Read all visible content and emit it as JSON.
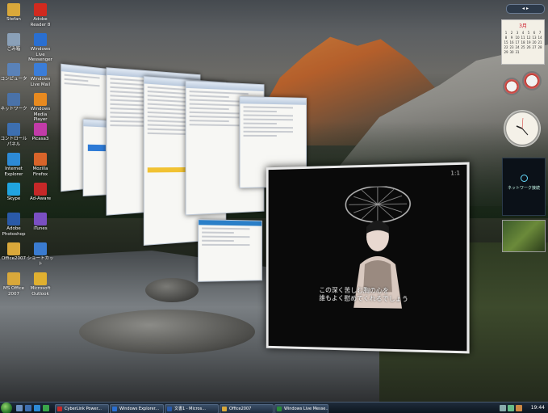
{
  "desktop_icons": [
    {
      "label": "Stefan",
      "color": "#d9a83a"
    },
    {
      "label": "Adobe Reader 8",
      "color": "#d12a1f"
    },
    {
      "label": "ごみ箱",
      "color": "#8aa0b8"
    },
    {
      "label": "Windows Live Messenger",
      "color": "#2a6fd1"
    },
    {
      "label": "コンピュータ",
      "color": "#5a82b8"
    },
    {
      "label": "Windows Live Mail",
      "color": "#3b7dd8"
    },
    {
      "label": "ネットワーク",
      "color": "#4a72a8"
    },
    {
      "label": "Windows Media Player",
      "color": "#e88a1f"
    },
    {
      "label": "コントロール パネル",
      "color": "#3d6fb0"
    },
    {
      "label": "Picasa3",
      "color": "#c23ba8"
    },
    {
      "label": "Internet Explorer",
      "color": "#2d8ad6"
    },
    {
      "label": "Mozilla Firefox",
      "color": "#d8642a"
    },
    {
      "label": "Skype",
      "color": "#20a4e0"
    },
    {
      "label": "Ad-Aware",
      "color": "#c62828"
    },
    {
      "label": "Adobe Photoshop",
      "color": "#2a5aa8"
    },
    {
      "label": "iTunes",
      "color": "#7a4fc2"
    },
    {
      "label": "Office2007",
      "color": "#d9a83a"
    },
    {
      "label": "ショートカット",
      "color": "#3a7bd0"
    },
    {
      "label": "MS Office 2007",
      "color": "#d9a83a"
    },
    {
      "label": "Microsoft Outlook",
      "color": "#e0b030"
    }
  ],
  "video_window": {
    "channel": "1:1",
    "subtitle": "この深く苦しむ胸の心を\n誰もよく慰めてくれるでしょう"
  },
  "gadgets": {
    "sidebar_toggle": "◂ ▸",
    "calendar_month": "3月",
    "calendar_days": [
      "1",
      "2",
      "3",
      "4",
      "5",
      "6",
      "7",
      "8",
      "9",
      "10",
      "11",
      "12",
      "13",
      "14",
      "15",
      "16",
      "17",
      "18",
      "19",
      "20",
      "21",
      "22",
      "23",
      "24",
      "25",
      "26",
      "27",
      "28",
      "29",
      "30",
      "31"
    ],
    "status_label": "ネットワーク接続"
  },
  "taskbar": {
    "tasks": [
      {
        "label": "CyberLink Power...",
        "color": "#c62828"
      },
      {
        "label": "Windows Explorer...",
        "color": "#2a6fd1"
      },
      {
        "label": "文書1 - Micros...",
        "color": "#2a5aa8"
      },
      {
        "label": "Office2007",
        "color": "#d9a83a"
      },
      {
        "label": "Windows Live Messe...",
        "color": "#2a8a3a"
      }
    ],
    "clock": "19:44"
  }
}
